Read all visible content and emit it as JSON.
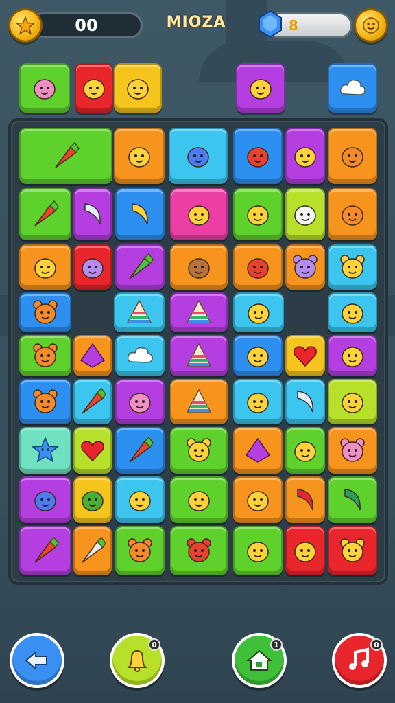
{
  "hud": {
    "score": "00",
    "title": "MIOZA",
    "gems": "8",
    "left_coin_icon": "star-coin-icon",
    "right_coin_icon": "smiley-coin-icon"
  },
  "colors": {
    "green": "#5fd12c",
    "red": "#e8262b",
    "yellow": "#f5c51d",
    "purple": "#b43ee0",
    "blue": "#2d8ff0",
    "orange": "#f7941d",
    "cyan": "#3cc6ef",
    "pink": "#ec3fa6",
    "lime": "#b6e02a",
    "mint": "#6fe0c0"
  },
  "top_row": [
    {
      "color": "green",
      "icon": "pink-blob-face-icon"
    },
    {
      "color": "red",
      "icon": "bird-icon"
    },
    {
      "color": "yellow",
      "icon": "leaf-icon"
    },
    {
      "color": "purple",
      "icon": "yellow-bird-icon"
    },
    {
      "color": "blue",
      "icon": "cloud-icon"
    }
  ],
  "board_rows": [
    [
      {
        "color": "green",
        "icon": "cat-and-carrot-icon",
        "wide": true
      },
      {
        "color": "orange",
        "icon": "ghost-face-icon"
      },
      {
        "color": "cyan",
        "icon": "blue-leaves-icon"
      },
      {
        "color": "blue",
        "icon": "red-ball-face-icon"
      },
      {
        "color": "purple",
        "icon": "person-with-hat-icon"
      },
      {
        "color": "orange",
        "icon": "orange-blob-icon"
      }
    ],
    [
      {
        "color": "green",
        "icon": "carrot-icon"
      },
      {
        "color": "purple",
        "icon": "moon-icon"
      },
      {
        "color": "blue",
        "icon": "banana-icon"
      },
      {
        "color": "pink",
        "icon": "yellow-blob-icon"
      },
      {
        "color": "green",
        "icon": "yellow-puzzle-icon"
      },
      {
        "color": "lime",
        "icon": "white-hand-icon"
      },
      {
        "color": "orange",
        "icon": "orange-face-icon"
      }
    ],
    [
      {
        "color": "orange",
        "icon": "sun-face-icon"
      },
      {
        "color": "red",
        "icon": "purple-square-face-icon"
      },
      {
        "color": "purple",
        "icon": "green-carrot-icon"
      },
      {
        "color": "orange",
        "icon": "brown-blob-icon"
      },
      {
        "color": "orange",
        "icon": "red-star-blob-icon"
      },
      {
        "color": "orange",
        "icon": "purple-cat-icon"
      },
      {
        "color": "cyan",
        "icon": "bear-face-icon"
      }
    ],
    [
      {
        "color": "blue",
        "icon": "orange-cat-icon"
      },
      {
        "color": "cyan",
        "icon": "triangle-stack-icon"
      },
      {
        "color": "purple",
        "icon": "triangle-stack-icon"
      },
      {
        "color": "cyan",
        "icon": "yellow-rect-face-icon"
      },
      {
        "color": "cyan",
        "icon": "yellow-blob-face-icon"
      }
    ],
    [
      {
        "color": "green",
        "icon": "orange-monster-icon"
      },
      {
        "color": "orange",
        "icon": "purple-diamond-icon"
      },
      {
        "color": "cyan",
        "icon": "white-cloud-icon"
      },
      {
        "color": "purple",
        "icon": "triangle-stack-icon"
      },
      {
        "color": "blue",
        "icon": "sun-icon"
      },
      {
        "color": "yellow",
        "icon": "red-apple-icon"
      },
      {
        "color": "purple",
        "icon": "ghost-face-icon"
      }
    ],
    [
      {
        "color": "blue",
        "icon": "orange-bear-icon"
      },
      {
        "color": "cyan",
        "icon": "carrot-icon"
      },
      {
        "color": "purple",
        "icon": "pink-ball-face-icon"
      },
      {
        "color": "orange",
        "icon": "triangle-stack-icon"
      },
      {
        "color": "cyan",
        "icon": "yellow-face-icon"
      },
      {
        "color": "cyan",
        "icon": "swirl-icon"
      },
      {
        "color": "lime",
        "icon": "yellow-face-icon"
      }
    ],
    [
      {
        "color": "mint",
        "icon": "blue-star-face-icon"
      },
      {
        "color": "lime",
        "icon": "red-heart-icon"
      },
      {
        "color": "blue",
        "icon": "paint-brush-icon"
      },
      {
        "color": "green",
        "icon": "yellow-fox-icon"
      },
      {
        "color": "orange",
        "icon": "purple-pyramid-icon"
      },
      {
        "color": "green",
        "icon": "yellow-bird-icon"
      },
      {
        "color": "orange",
        "icon": "pink-cat-icon"
      }
    ],
    [
      {
        "color": "purple",
        "icon": "blue-bean-icon"
      },
      {
        "color": "yellow",
        "icon": "green-balloon-icon"
      },
      {
        "color": "cyan",
        "icon": "bread-icon"
      },
      {
        "color": "green",
        "icon": "yellow-chick-icon"
      },
      {
        "color": "orange",
        "icon": "feather-icon"
      },
      {
        "color": "orange",
        "icon": "red-pepper-icon"
      },
      {
        "color": "green",
        "icon": "green-swirl-icon"
      }
    ],
    [
      {
        "color": "purple",
        "icon": "ice-cream-icon"
      },
      {
        "color": "orange",
        "icon": "pencil-icon"
      },
      {
        "color": "green",
        "icon": "orange-fox-icon"
      },
      {
        "color": "green",
        "icon": "red-cat-icon"
      },
      {
        "color": "green",
        "icon": "yellow-face-icon"
      },
      {
        "color": "red",
        "icon": "yellow-bird-icon"
      },
      {
        "color": "red",
        "icon": "bear-face-icon"
      }
    ]
  ],
  "bottom_buttons": [
    {
      "name": "back-button",
      "color": "blue",
      "icon": "back-arrow-icon",
      "badge": ""
    },
    {
      "name": "bell-button",
      "color": "lime",
      "icon": "bell-icon",
      "badge": "0"
    },
    {
      "name": "home-button",
      "color": "green",
      "icon": "home-icon",
      "badge": "1"
    },
    {
      "name": "music-button",
      "color": "red",
      "icon": "music-note-icon",
      "badge": "0"
    }
  ]
}
